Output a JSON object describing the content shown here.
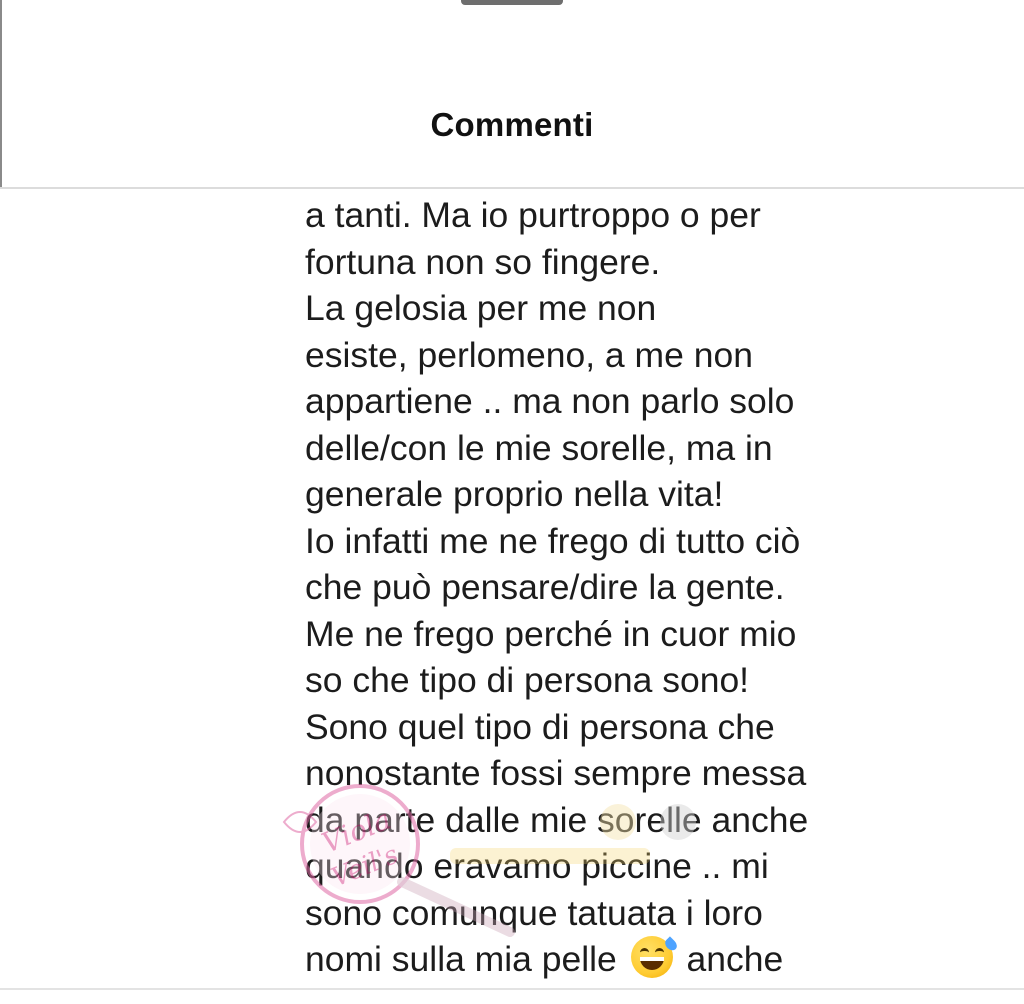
{
  "header": {
    "title": "Commenti"
  },
  "comment": {
    "lines": [
      "a tanti. Ma io purtroppo o per",
      "fortuna non so fingere.",
      "La gelosia per me non",
      "esiste, perlomeno, a me non",
      "appartiene .. ma non parlo solo",
      "delle/con le mie sorelle, ma in",
      "generale proprio nella vita!",
      "Io infatti me ne frego di tutto ciò",
      "che può pensare/dire la gente.",
      "Me ne frego perché in cuor mio",
      "so che tipo di persona sono!",
      "Sono quel tipo di persona che",
      "nonostante fossi sempre messa",
      "da parte dalle mie sorelle anche",
      "quando eravamo piccine .. mi",
      "sono comunque tatuata i loro"
    ],
    "last_line_before_emoji": "nomi sulla mia pelle",
    "emoji": "grinning-face-with-sweat-icon",
    "last_line_after_emoji": "anche"
  },
  "watermark": {
    "text": "Viola Veil's"
  },
  "colors": {
    "text": "#1c1c1c",
    "divider": "#dcdcdc",
    "handle": "#6e6e6e",
    "watermark": "#e06aa5"
  }
}
